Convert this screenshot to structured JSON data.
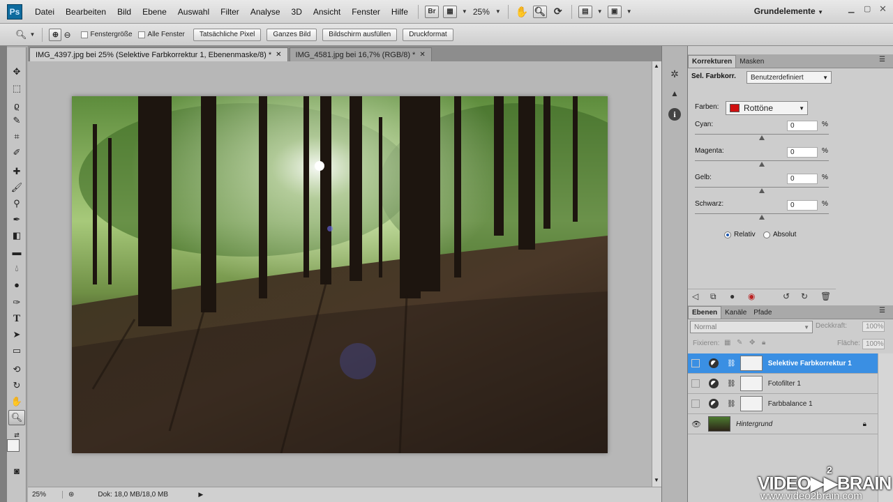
{
  "app": {
    "logo": "Ps"
  },
  "menu": [
    "Datei",
    "Bearbeiten",
    "Bild",
    "Ebene",
    "Auswahl",
    "Filter",
    "Analyse",
    "3D",
    "Ansicht",
    "Fenster",
    "Hilfe"
  ],
  "menubar": {
    "bridge": "Br",
    "zoom": "25%",
    "workspace": "Grundelemente"
  },
  "options": {
    "window_size": "Fenstergröße",
    "all_windows": "Alle Fenster",
    "actual_pixels": "Tatsächliche Pixel",
    "fit_screen": "Ganzes Bild",
    "fill_screen": "Bildschirm ausfüllen",
    "print_size": "Druckformat"
  },
  "tabs": [
    {
      "label": "IMG_4397.jpg bei 25% (Selektive Farbkorrektur 1, Ebenenmaske/8) *",
      "active": true
    },
    {
      "label": "IMG_4581.jpg bei 16,7% (RGB/8) *",
      "active": false
    }
  ],
  "status": {
    "zoom": "25%",
    "doc": "Dok: 18,0 MB/18,0 MB"
  },
  "korrekturen": {
    "tabs": [
      "Korrekturen",
      "Masken"
    ],
    "title": "Sel. Farbkorr.",
    "preset": "Benutzerdefiniert",
    "farben_label": "Farben:",
    "farben_value": "Rottöne",
    "swatch_color": "#d01010",
    "sliders": [
      {
        "label": "Cyan:",
        "value": "0",
        "unit": "%"
      },
      {
        "label": "Magenta:",
        "value": "0",
        "unit": "%"
      },
      {
        "label": "Gelb:",
        "value": "0",
        "unit": "%"
      },
      {
        "label": "Schwarz:",
        "value": "0",
        "unit": "%"
      }
    ],
    "relativ": "Relativ",
    "absolut": "Absolut"
  },
  "ebenen": {
    "tabs": [
      "Ebenen",
      "Kanäle",
      "Pfade"
    ],
    "blend": "Normal",
    "opacity_label": "Deckkraft:",
    "opacity": "100%",
    "lock_label": "Fixieren:",
    "fill_label": "Fläche:",
    "fill": "100%",
    "layers": [
      {
        "name": "Selektive Farbkorrektur 1",
        "selected": true
      },
      {
        "name": "Fotofilter 1",
        "selected": false
      },
      {
        "name": "Farbbalance 1",
        "selected": false
      },
      {
        "name": "Hintergrund",
        "selected": false
      }
    ]
  },
  "watermark": {
    "brand": "VIDEO▶▶BRAIN",
    "sup": "2",
    "url": "www.video2brain.com"
  }
}
